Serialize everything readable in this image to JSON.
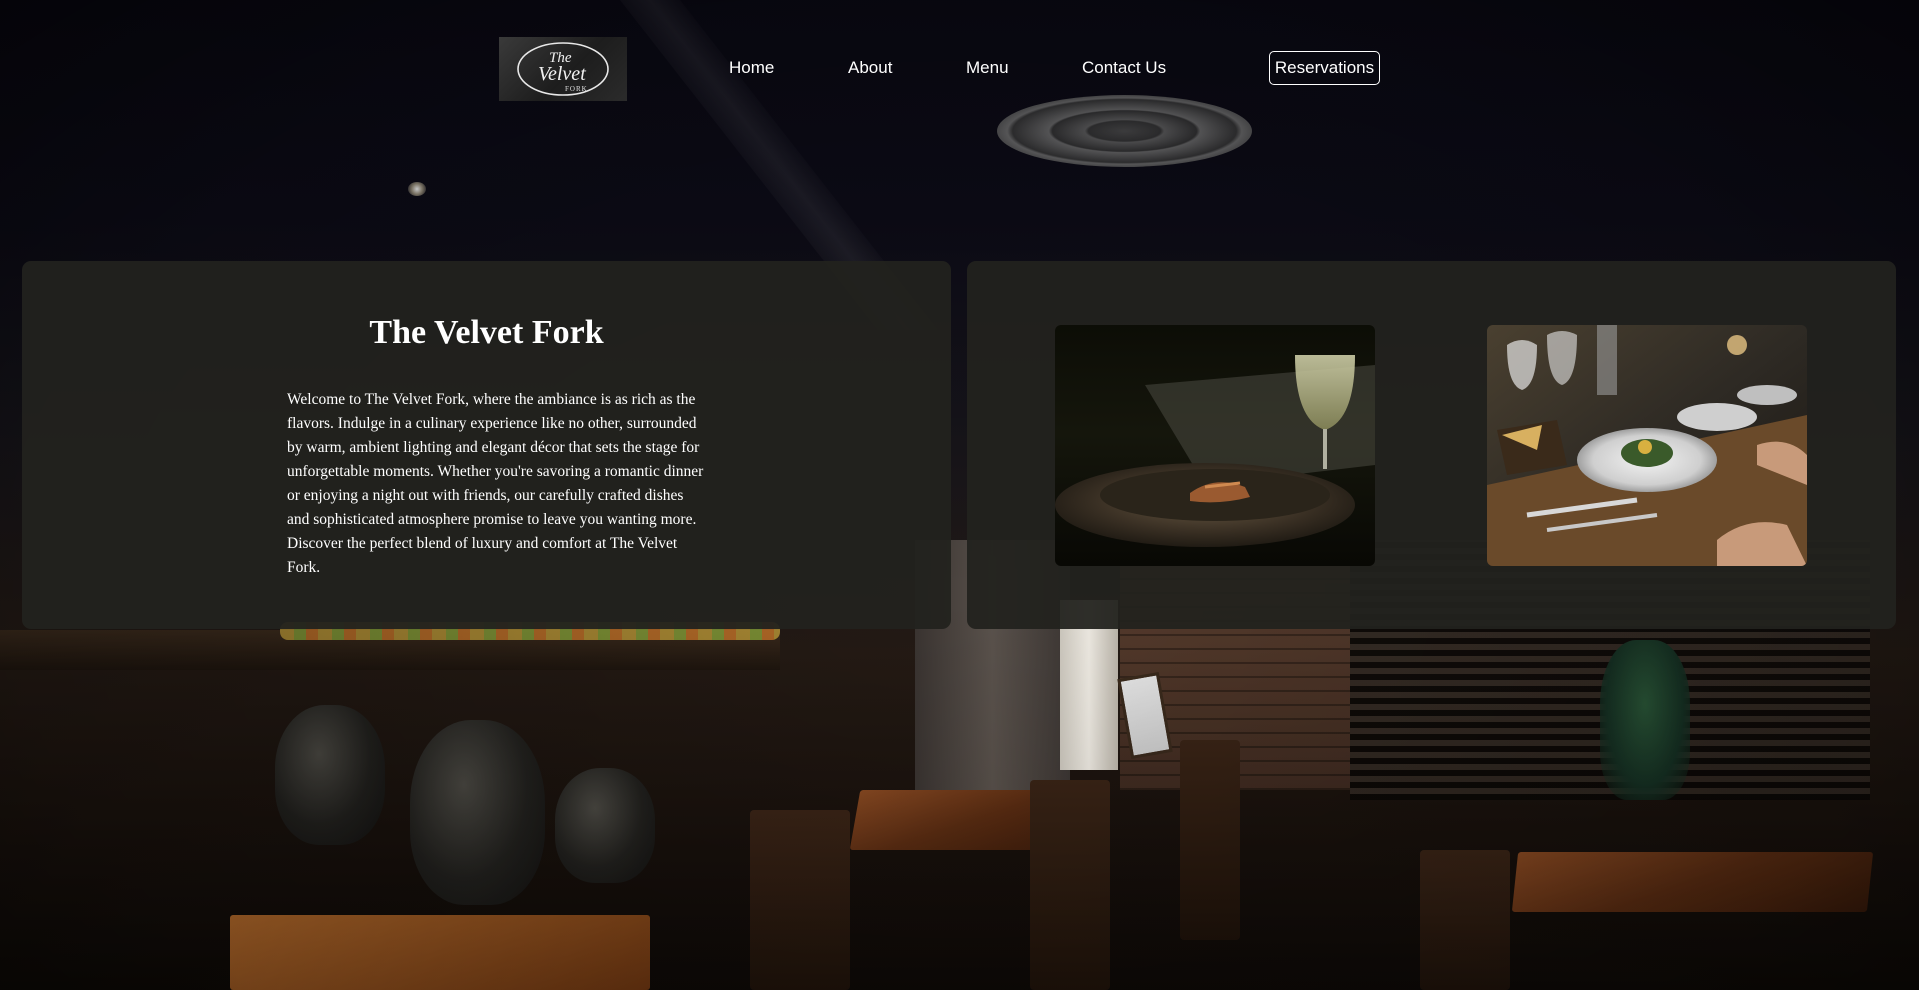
{
  "brand": {
    "logo_line1": "The",
    "logo_line2": "Velvet",
    "logo_line3": "FORK"
  },
  "nav": {
    "items": [
      {
        "label": "Home"
      },
      {
        "label": "About"
      },
      {
        "label": "Menu"
      },
      {
        "label": "Contact Us"
      }
    ],
    "cta_label": "Reservations"
  },
  "about": {
    "title": "The Velvet Fork",
    "body": "Welcome to The Velvet Fork, where the ambiance is as rich as the flavors. Indulge in a culinary experience like no other, surrounded by warm, ambient lighting and elegant décor that sets the stage for unforgettable moments. Whether you're savoring a romantic dinner or enjoying a night out with friends, our carefully crafted dishes and sophisticated atmosphere promise to leave you wanting more. Discover the perfect blend of luxury and comfort at The Velvet Fork."
  },
  "gallery": {
    "images": [
      {
        "icon": "plated-dish-with-wine-photo"
      },
      {
        "icon": "dining-table-with-guests-photo"
      }
    ]
  },
  "colors": {
    "card_bg": "#22221e",
    "text": "#ffffff",
    "page_bg": "#0b0a14"
  }
}
